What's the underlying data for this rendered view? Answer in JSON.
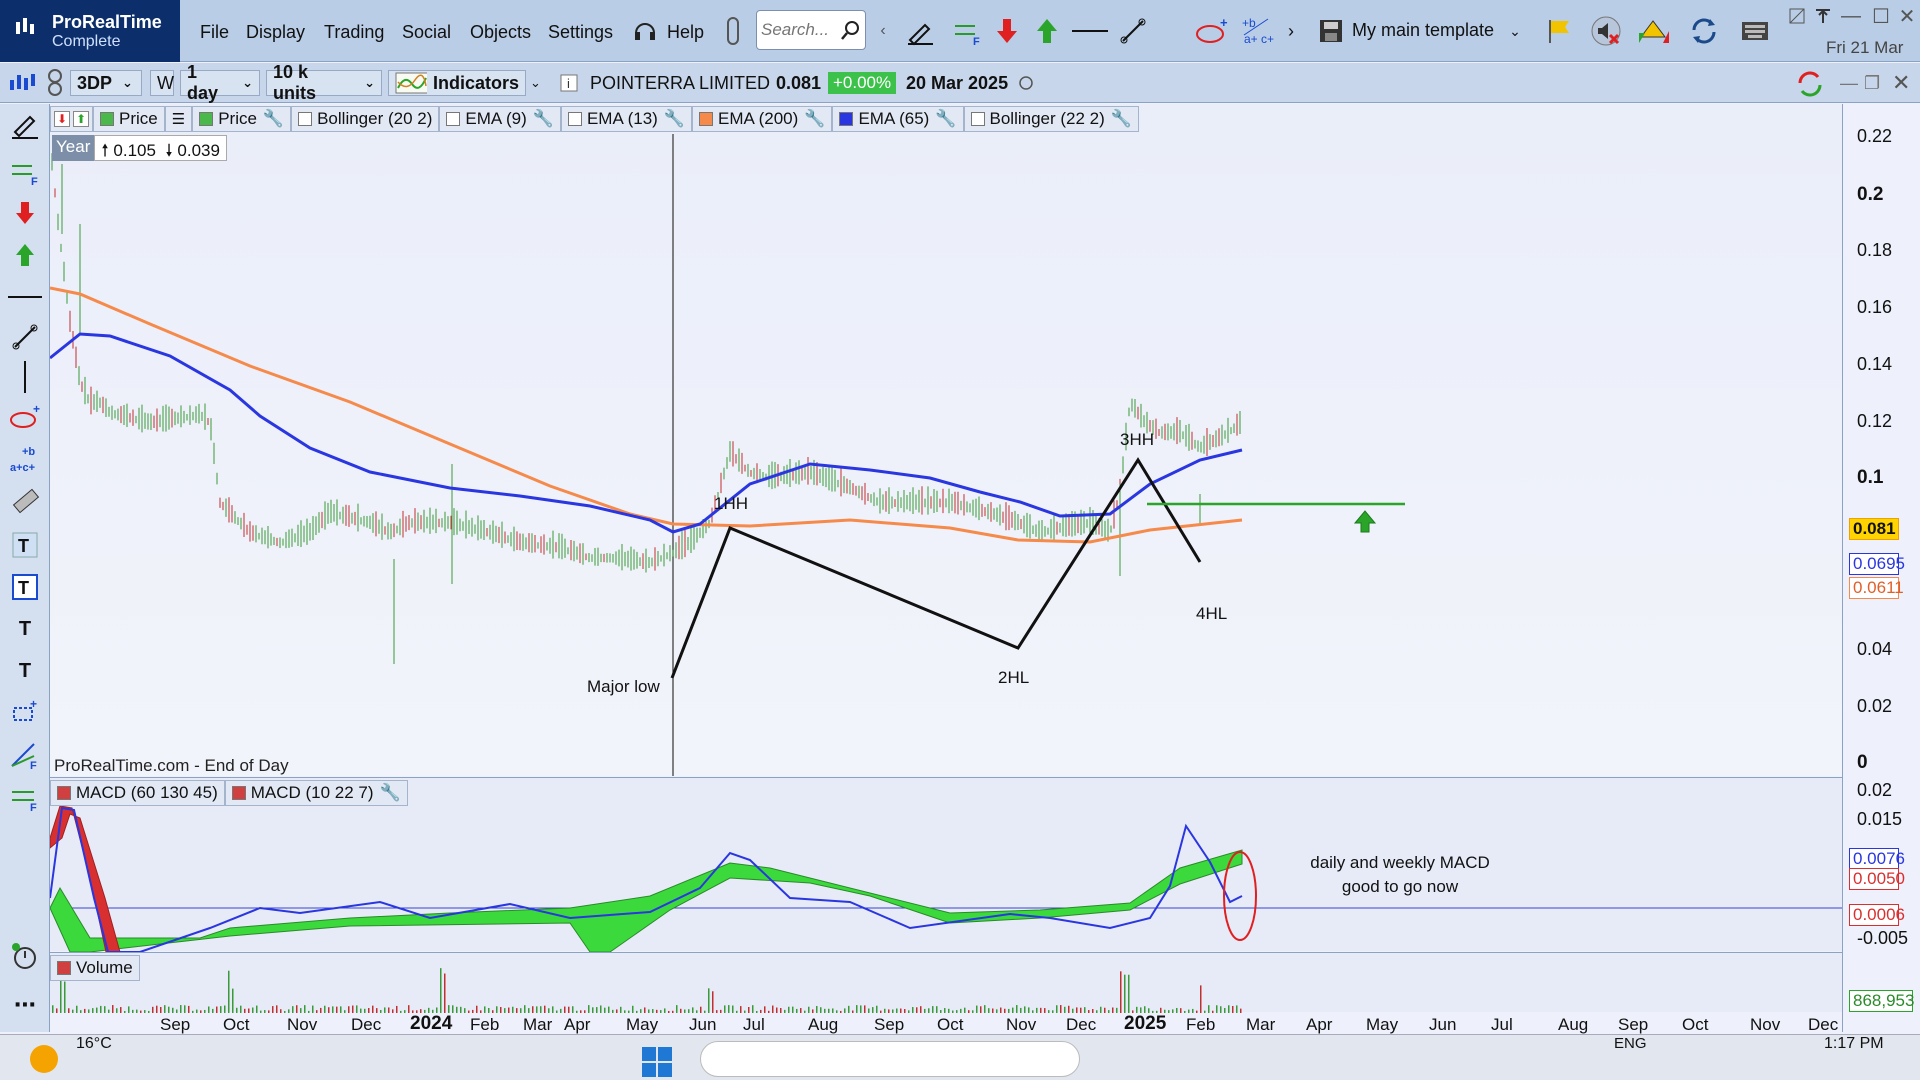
{
  "app": {
    "name": "ProRealTime",
    "edition": "Complete"
  },
  "menu": [
    "File",
    "Display",
    "Trading",
    "Social",
    "Objects",
    "Settings"
  ],
  "help_label": "Help",
  "search": {
    "placeholder": "Search..."
  },
  "template": {
    "label": "My main template"
  },
  "date_short": "Fri 21 Mar",
  "toolbar2": {
    "ticker": "3DP",
    "period_w": "W",
    "timeframe": "1 day",
    "units": "10 k units",
    "indicators_label": "Indicators",
    "company": "POINTERRA LIMITED",
    "last_price": "0.081",
    "change": "+0.00%",
    "date": "20 Mar 2025"
  },
  "indicators": [
    {
      "label": "Price",
      "color": "#4ab84a"
    },
    {
      "label": "Price",
      "color": "#4ab84a"
    },
    {
      "label": "Bollinger (20 2)",
      "color": "#ffffff"
    },
    {
      "label": "EMA (9)",
      "color": "#ffffff"
    },
    {
      "label": "EMA (13)",
      "color": "#ffffff"
    },
    {
      "label": "EMA (200)",
      "color": "#f58a4b"
    },
    {
      "label": "EMA (65)",
      "color": "#2a36e0"
    },
    {
      "label": "Bollinger (22 2)",
      "color": "#ffffff"
    }
  ],
  "range": {
    "period": "Year",
    "high": "0.105",
    "low": "0.039"
  },
  "price_axis": [
    "0.22",
    "0.2",
    "0.18",
    "0.16",
    "0.14",
    "0.12",
    "0.1",
    "0.04",
    "0.02",
    "0"
  ],
  "price_tags": {
    "last": "0.081",
    "ema65": "0.0695",
    "ema200": "0.0611"
  },
  "macd_indicators": [
    {
      "label": "MACD (60 130 45)",
      "color": "#d04040"
    },
    {
      "label": "MACD (10 22 7)",
      "color": "#d04040"
    }
  ],
  "macd_axis": [
    "0.02",
    "0.015",
    "-0.005"
  ],
  "macd_tags": [
    "0.0076",
    "0.0050",
    "0.0006"
  ],
  "volume": {
    "label": "Volume",
    "tag": "868,953"
  },
  "x_axis": [
    "Sep",
    "Oct",
    "Nov",
    "Dec",
    "2024",
    "Feb",
    "Mar",
    "Apr",
    "May",
    "Jun",
    "Jul",
    "Aug",
    "Sep",
    "Oct",
    "Nov",
    "Dec",
    "2025",
    "Feb",
    "Mar",
    "Apr",
    "May",
    "Jun",
    "Jul",
    "Aug",
    "Sep",
    "Oct",
    "Nov",
    "Dec"
  ],
  "annotations": {
    "major_low": "Major low",
    "hh1": "1HH",
    "hl2": "2HL",
    "hh3": "3HH",
    "hl4": "4HL",
    "macd_note_1": "daily and weekly MACD",
    "macd_note_2": "good to go now",
    "source": "ProRealTime.com - End of Day"
  },
  "colors": {
    "ema200": "#f58a4b",
    "ema65": "#2a36e0",
    "resistance": "#2aa52a",
    "candle": "#3a9a3a",
    "macd_fill": "#3bd93b",
    "macd_red": "#d83030"
  },
  "taskbar": {
    "temp": "16°C",
    "lang": "ENG",
    "time": "1:17 PM"
  }
}
